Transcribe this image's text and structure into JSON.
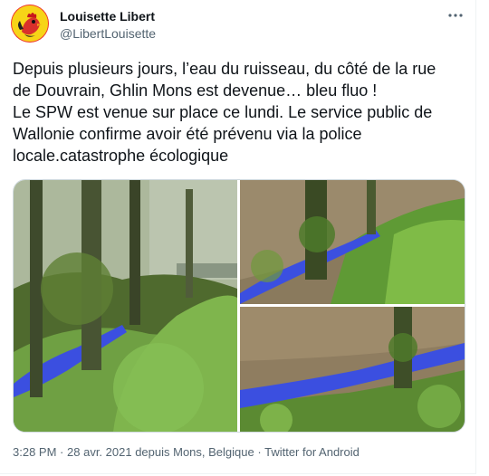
{
  "tweet": {
    "author": {
      "display_name": "Louisette Libert",
      "handle": "@LibertLouisette",
      "avatar_icon": "rooster-avatar"
    },
    "more_icon": "more-horizontal-icon",
    "text_lines": [
      "Depuis plusieurs jours, l’eau du ruisseau, du côté de la rue",
      "de Douvrain,  Ghlin Mons est devenue… bleu fluo !",
      "Le SPW est venue sur place ce lundi. Le service public de",
      "Wallonie confirme avoir été prévenu via la police",
      "locale.catastrophe écologique"
    ],
    "media_count": 3,
    "meta": {
      "time": "3:28 PM",
      "separator": "·",
      "date": "28 avr. 2021",
      "location": "depuis Mons, Belgique",
      "source": "Twitter for Android"
    }
  },
  "colors": {
    "text": "#0f1419",
    "secondary": "#536471",
    "border": "#cfd9de",
    "water_blue": "#3b4fe0"
  }
}
